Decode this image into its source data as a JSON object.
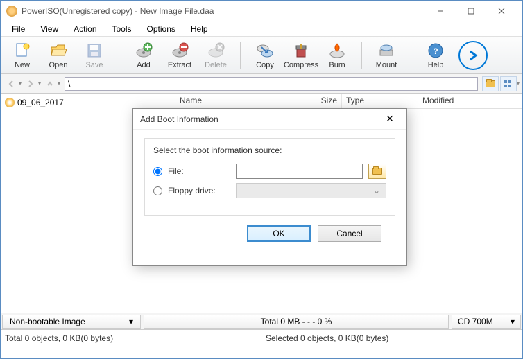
{
  "window": {
    "title": "PowerISO(Unregistered copy) - New Image File.daa"
  },
  "menu": [
    "File",
    "View",
    "Action",
    "Tools",
    "Options",
    "Help"
  ],
  "toolbar": {
    "new": "New",
    "open": "Open",
    "save": "Save",
    "add": "Add",
    "extract": "Extract",
    "delete": "Delete",
    "copy": "Copy",
    "compress": "Compress",
    "burn": "Burn",
    "mount": "Mount",
    "help": "Help"
  },
  "nav": {
    "path": "\\"
  },
  "tree": {
    "root": "09_06_2017"
  },
  "columns": {
    "name": "Name",
    "size": "Size",
    "type": "Type",
    "modified": "Modified"
  },
  "status": {
    "image_type": "Non-bootable Image",
    "total": "Total  0 MB    - - -  0 %",
    "capacity": "CD 700M"
  },
  "bottom": {
    "left": "Total 0 objects, 0 KB(0 bytes)",
    "right": "Selected 0 objects, 0 KB(0 bytes)"
  },
  "dialog": {
    "title": "Add Boot Information",
    "group_label": "Select the boot information source:",
    "file_label": "File:",
    "floppy_label": "Floppy drive:",
    "file_value": "",
    "ok": "OK",
    "cancel": "Cancel"
  }
}
